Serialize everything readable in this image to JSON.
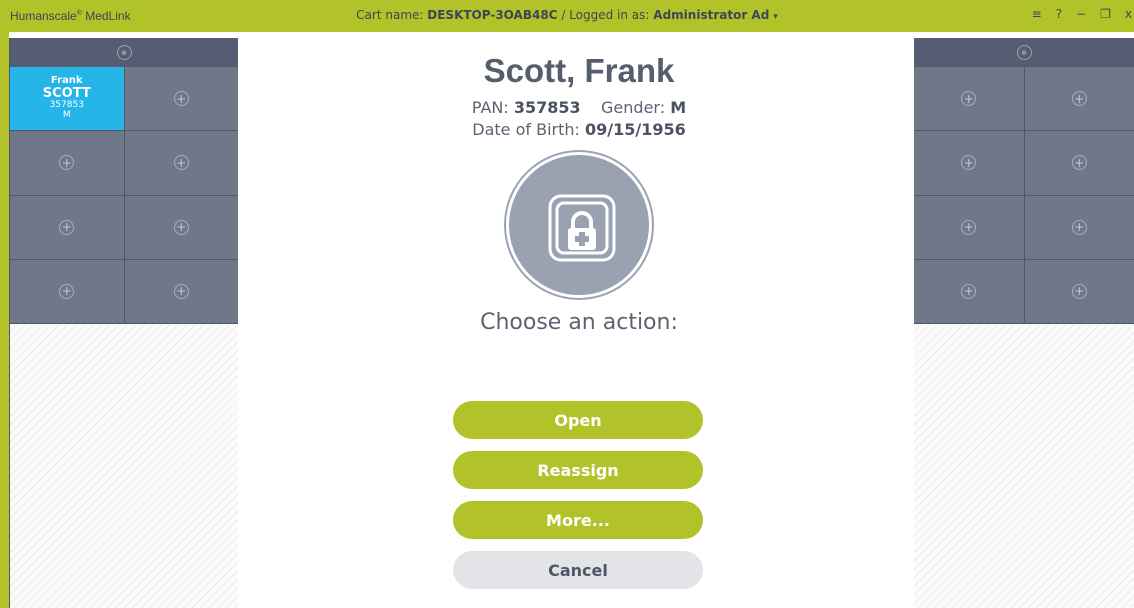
{
  "titlebar": {
    "brand": "Humanscale",
    "brand_mark": "®",
    "brand_suffix": " MedLink",
    "cart_label": "Cart name:",
    "cart_name": "DESKTOP-3OAB48C",
    "separator": "/",
    "login_label": "Logged in as:",
    "user": "Administrator Ad",
    "caret": "▾",
    "menu_icon": "≡",
    "help_icon": "?",
    "minimize_icon": "−",
    "restore_icon": "❐",
    "close_icon": "x"
  },
  "left_panel": {
    "header_icon": "⊕",
    "active_patient": {
      "first": "Frank",
      "last": "SCOTT",
      "pan": "357853",
      "gender": "M"
    },
    "plus": "+"
  },
  "right_panel": {
    "header_icon": "⊕",
    "plus": "+"
  },
  "dialog": {
    "name": "Scott, Frank",
    "pan_label": "PAN:",
    "pan": "357853",
    "gender_label": "Gender:",
    "gender": "M",
    "dob_label": "Date of Birth:",
    "dob": "09/15/1956",
    "lock_icon": "lock-medical-icon",
    "prompt": "Choose an action:",
    "buttons": {
      "open": "Open",
      "reassign": "Reassign",
      "more": "More...",
      "cancel": "Cancel"
    }
  },
  "colors": {
    "accent": "#b2c229",
    "active_slot": "#25b5e8",
    "slot": "#6f7789",
    "header": "#545d71"
  }
}
